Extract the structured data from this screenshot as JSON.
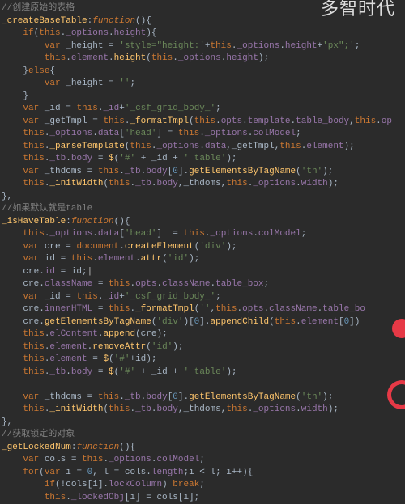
{
  "watermark": "多智时代",
  "code": {
    "l01": "//创建原始的表格",
    "l02a": "_createBaseTable",
    "l02b": ":",
    "l02c": "function",
    "l02d": "(){",
    "l03a": "    ",
    "l03b": "if",
    "l03c": "(",
    "l03d": "this",
    "l03e": ".",
    "l03f": "_options",
    "l03g": ".",
    "l03h": "height",
    "l03i": "){",
    "l04a": "        ",
    "l04b": "var",
    "l04c": " _height = ",
    "l04d": "'style=\"height:'",
    "l04e": "+",
    "l04f": "this",
    "l04g": ".",
    "l04h": "_options",
    "l04i": ".",
    "l04j": "height",
    "l04k": "+",
    "l04l": "'px\";'",
    "l04m": ";",
    "l05a": "        ",
    "l05b": "this",
    "l05c": ".",
    "l05d": "element",
    "l05e": ".",
    "l05f": "height",
    "l05g": "(",
    "l05h": "this",
    "l05i": ".",
    "l05j": "_options",
    "l05k": ".",
    "l05l": "height",
    "l05m": ");",
    "l06a": "    }",
    "l06b": "else",
    "l06c": "{",
    "l07a": "        ",
    "l07b": "var",
    "l07c": " _height = ",
    "l07d": "''",
    "l07e": ";",
    "l08": "    }",
    "l09a": "    ",
    "l09b": "var",
    "l09c": " _id = ",
    "l09d": "this",
    "l09e": ".",
    "l09f": "_id",
    "l09g": "+",
    "l09h": "'_csf_grid_body_'",
    "l09i": ";",
    "l10a": "    ",
    "l10b": "var",
    "l10c": " _getTmpl = ",
    "l10d": "this",
    "l10e": ".",
    "l10f": "_formatTmpl",
    "l10g": "(",
    "l10h": "this",
    "l10i": ".",
    "l10j": "opts",
    "l10k": ".",
    "l10l": "template",
    "l10m": ".",
    "l10n": "table_body",
    "l10o": ",",
    "l10p": "this",
    "l10q": ".",
    "l10r": "op",
    "l11a": "    ",
    "l11b": "this",
    "l11c": ".",
    "l11d": "_options",
    "l11e": ".",
    "l11f": "data",
    "l11g": "[",
    "l11h": "'head'",
    "l11i": "] = ",
    "l11j": "this",
    "l11k": ".",
    "l11l": "_options",
    "l11m": ".",
    "l11n": "colModel",
    "l11o": ";",
    "l12a": "    ",
    "l12b": "this",
    "l12c": ".",
    "l12d": "_parseTemplate",
    "l12e": "(",
    "l12f": "this",
    "l12g": ".",
    "l12h": "_options",
    "l12i": ".",
    "l12j": "data",
    "l12k": ",_getTmpl,",
    "l12l": "this",
    "l12m": ".",
    "l12n": "element",
    "l12o": ");",
    "l13a": "    ",
    "l13b": "this",
    "l13c": ".",
    "l13d": "_tb",
    "l13e": ".",
    "l13f": "body",
    "l13g": " = ",
    "l13h": "$",
    "l13i": "(",
    "l13j": "'#'",
    "l13k": " + _id + ",
    "l13l": "' table'",
    "l13m": ");",
    "l14a": "    ",
    "l14b": "var",
    "l14c": " _thdoms = ",
    "l14d": "this",
    "l14e": ".",
    "l14f": "_tb",
    "l14g": ".",
    "l14h": "body",
    "l14i": "[",
    "l14j": "0",
    "l14k": "].",
    "l14l": "getElementsByTagName",
    "l14m": "(",
    "l14n": "'th'",
    "l14o": ");",
    "l15a": "    ",
    "l15b": "this",
    "l15c": ".",
    "l15d": "_initWidth",
    "l15e": "(",
    "l15f": "this",
    "l15g": ".",
    "l15h": "_tb",
    "l15i": ".",
    "l15j": "body",
    "l15k": ",_thdoms,",
    "l15l": "this",
    "l15m": ".",
    "l15n": "_options",
    "l15o": ".",
    "l15p": "width",
    "l15q": ");",
    "l16": "},",
    "l17": "//如果默认就是table",
    "l18a": "_isHaveTable",
    "l18b": ":",
    "l18c": "function",
    "l18d": "(){",
    "l19a": "    ",
    "l19b": "this",
    "l19c": ".",
    "l19d": "_options",
    "l19e": ".",
    "l19f": "data",
    "l19g": "[",
    "l19h": "'head'",
    "l19i": "]  = ",
    "l19j": "this",
    "l19k": ".",
    "l19l": "_options",
    "l19m": ".",
    "l19n": "colModel",
    "l19o": ";",
    "l20a": "    ",
    "l20b": "var",
    "l20c": " cre = ",
    "l20d": "document",
    "l20e": ".",
    "l20f": "createElement",
    "l20g": "(",
    "l20h": "'div'",
    "l20i": ");",
    "l21a": "    ",
    "l21b": "var",
    "l21c": " id = ",
    "l21d": "this",
    "l21e": ".",
    "l21f": "element",
    "l21g": ".",
    "l21h": "attr",
    "l21i": "(",
    "l21j": "'id'",
    "l21k": ");",
    "l22a": "    cre.",
    "l22b": "id",
    "l22c": " = id;",
    "l22d": "|",
    "l23a": "    cre.",
    "l23b": "className",
    "l23c": " = ",
    "l23d": "this",
    "l23e": ".",
    "l23f": "opts",
    "l23g": ".",
    "l23h": "className",
    "l23i": ".",
    "l23j": "table_box",
    "l23k": ";",
    "l24a": "    ",
    "l24b": "var",
    "l24c": " _id = ",
    "l24d": "this",
    "l24e": ".",
    "l24f": "_id",
    "l24g": "+",
    "l24h": "'_csf_grid_body_'",
    "l24i": ";",
    "l25a": "    cre.",
    "l25b": "innerHTML",
    "l25c": " = ",
    "l25d": "this",
    "l25e": ".",
    "l25f": "_formatTmpl",
    "l25g": "(",
    "l25h": "''",
    "l25i": ",",
    "l25j": "this",
    "l25k": ".",
    "l25l": "opts",
    "l25m": ".",
    "l25n": "className",
    "l25o": ".",
    "l25p": "table_bo",
    "l26a": "    cre.",
    "l26b": "getElementsByTagName",
    "l26c": "(",
    "l26d": "'div'",
    "l26e": ")[",
    "l26f": "0",
    "l26g": "].",
    "l26h": "appendChild",
    "l26i": "(",
    "l26j": "this",
    "l26k": ".",
    "l26l": "element",
    "l26m": "[",
    "l26n": "0",
    "l26o": "])",
    "l27a": "    ",
    "l27b": "this",
    "l27c": ".",
    "l27d": "elContent",
    "l27e": ".",
    "l27f": "append",
    "l27g": "(cre);",
    "l28a": "    ",
    "l28b": "this",
    "l28c": ".",
    "l28d": "element",
    "l28e": ".",
    "l28f": "removeAttr",
    "l28g": "(",
    "l28h": "'id'",
    "l28i": ");",
    "l29a": "    ",
    "l29b": "this",
    "l29c": ".",
    "l29d": "element",
    "l29e": " = ",
    "l29f": "$",
    "l29g": "(",
    "l29h": "'#'",
    "l29i": "+id);",
    "l30a": "    ",
    "l30b": "this",
    "l30c": ".",
    "l30d": "_tb",
    "l30e": ".",
    "l30f": "body",
    "l30g": " = ",
    "l30h": "$",
    "l30i": "(",
    "l30j": "'#'",
    "l30k": " + _id + ",
    "l30l": "' table'",
    "l30m": ");",
    "l31": "",
    "l32a": "    ",
    "l32b": "var",
    "l32c": " _thdoms = ",
    "l32d": "this",
    "l32e": ".",
    "l32f": "_tb",
    "l32g": ".",
    "l32h": "body",
    "l32i": "[",
    "l32j": "0",
    "l32k": "].",
    "l32l": "getElementsByTagName",
    "l32m": "(",
    "l32n": "'th'",
    "l32o": ");",
    "l33a": "    ",
    "l33b": "this",
    "l33c": ".",
    "l33d": "_initWidth",
    "l33e": "(",
    "l33f": "this",
    "l33g": ".",
    "l33h": "_tb",
    "l33i": ".",
    "l33j": "body",
    "l33k": ",_thdoms,",
    "l33l": "this",
    "l33m": ".",
    "l33n": "_options",
    "l33o": ".",
    "l33p": "width",
    "l33q": ");",
    "l34": "},",
    "l35": "//获取锁定的对象",
    "l36a": "_getLockedNum",
    "l36b": ":",
    "l36c": "function",
    "l36d": "(){",
    "l37a": "    ",
    "l37b": "var",
    "l37c": " cols = ",
    "l37d": "this",
    "l37e": ".",
    "l37f": "_options",
    "l37g": ".",
    "l37h": "colModel",
    "l37i": ";",
    "l38a": "    ",
    "l38b": "for",
    "l38c": "(",
    "l38d": "var",
    "l38e": " i = ",
    "l38f": "0",
    "l38g": ", l = cols.",
    "l38h": "length",
    "l38i": ";i < l; i++){",
    "l39a": "        ",
    "l39b": "if",
    "l39c": "(!cols[i].",
    "l39d": "lockColumn",
    "l39e": ") ",
    "l39f": "break",
    "l39g": ";",
    "l40a": "        ",
    "l40b": "this",
    "l40c": ".",
    "l40d": "_lockedObj",
    "l40e": "[i] = cols[i];"
  }
}
